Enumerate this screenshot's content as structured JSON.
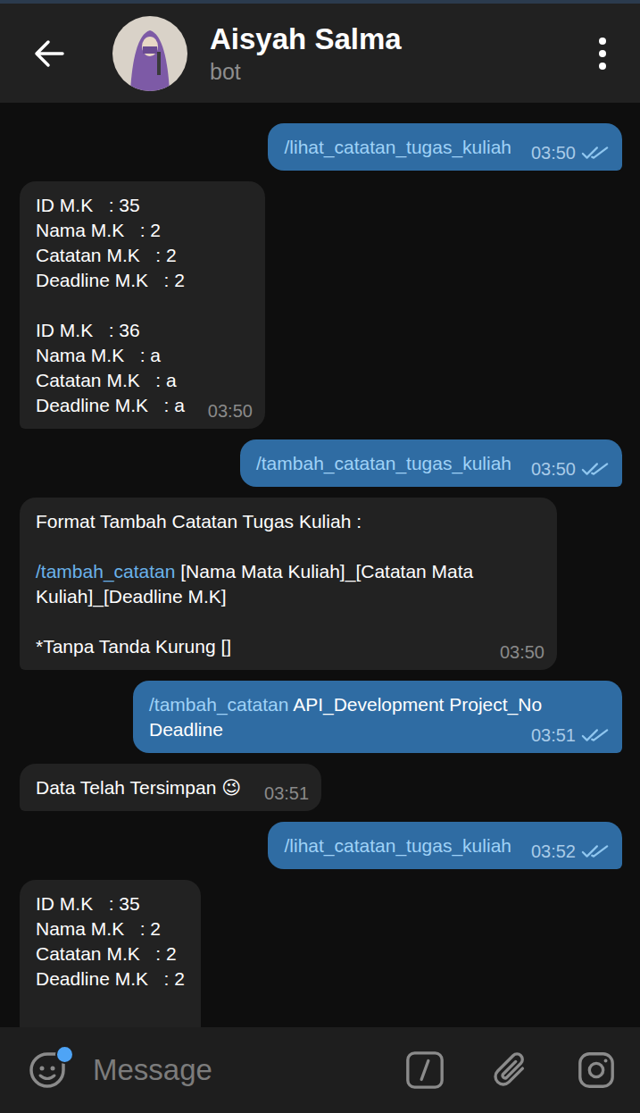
{
  "header": {
    "title": "Aisyah Salma",
    "subtitle": "bot"
  },
  "messages": [
    {
      "dir": "out",
      "time": "03:50",
      "read": true,
      "lines": [
        [
          {
            "text": "/lihat_catatan_tugas_kuliah",
            "link": true
          }
        ]
      ]
    },
    {
      "dir": "in",
      "time": "03:50",
      "lines": [
        [
          {
            "text": "ID M.K   : 35",
            "link": false
          }
        ],
        [
          {
            "text": "Nama M.K   : 2",
            "link": false
          }
        ],
        [
          {
            "text": "Catatan M.K   : 2",
            "link": false
          }
        ],
        [
          {
            "text": "Deadline M.K   : 2",
            "link": false
          }
        ],
        [],
        [
          {
            "text": "ID M.K   : 36",
            "link": false
          }
        ],
        [
          {
            "text": "Nama M.K   : a",
            "link": false
          }
        ],
        [
          {
            "text": "Catatan M.K   : a",
            "link": false
          }
        ],
        [
          {
            "text": "Deadline M.K   : a",
            "link": false
          }
        ]
      ]
    },
    {
      "dir": "out",
      "time": "03:50",
      "read": true,
      "lines": [
        [
          {
            "text": "/tambah_catatan_tugas_kuliah",
            "link": true
          }
        ]
      ]
    },
    {
      "dir": "in",
      "time": "03:50",
      "lines": [
        [
          {
            "text": "Format Tambah Catatan Tugas Kuliah :",
            "link": false
          }
        ],
        [],
        [
          {
            "text": "/tambah_catatan",
            "link": true
          },
          {
            "text": " [Nama Mata Kuliah]_[Catatan Mata Kuliah]_[Deadline M.K]",
            "link": false
          }
        ],
        [],
        [
          {
            "text": "*Tanpa Tanda Kurung []",
            "link": false
          }
        ]
      ]
    },
    {
      "dir": "out",
      "time": "03:51",
      "read": true,
      "lines": [
        [
          {
            "text": "/tambah_catatan",
            "link": true
          },
          {
            "text": " API_Development Project_No Deadline",
            "link": false
          }
        ]
      ]
    },
    {
      "dir": "in",
      "time": "03:51",
      "lines": [
        [
          {
            "text": "Data Telah Tersimpan ",
            "link": false
          },
          {
            "text": "😉",
            "link": false
          }
        ]
      ]
    },
    {
      "dir": "out",
      "time": "03:52",
      "read": true,
      "lines": [
        [
          {
            "text": "/lihat_catatan_tugas_kuliah",
            "link": true
          }
        ]
      ]
    },
    {
      "dir": "in",
      "lines": [
        [
          {
            "text": "ID M.K   : 35",
            "link": false
          }
        ],
        [
          {
            "text": "Nama M.K   : 2",
            "link": false
          }
        ],
        [
          {
            "text": "Catatan M.K   : 2",
            "link": false
          }
        ],
        [
          {
            "text": "Deadline M.K   : 2",
            "link": false
          }
        ]
      ]
    }
  ],
  "composer": {
    "placeholder": "Message",
    "emoji_badge": true
  }
}
